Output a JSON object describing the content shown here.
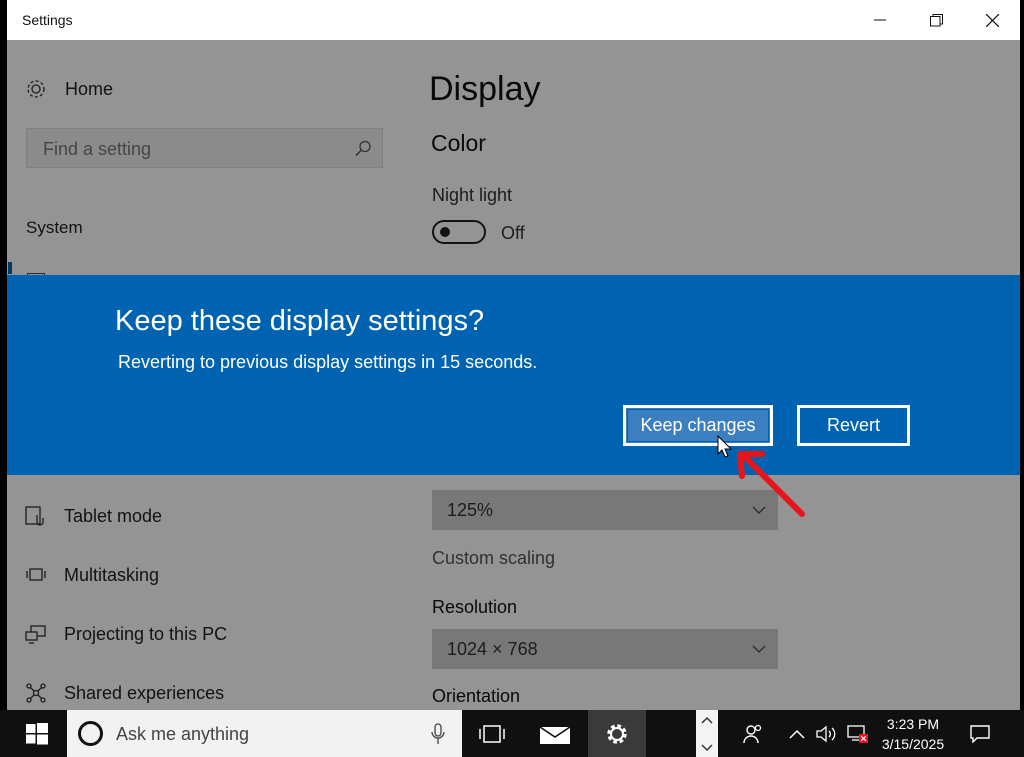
{
  "window": {
    "title": "Settings",
    "controls": {
      "minimize": "minimize-icon",
      "restore": "restore-icon",
      "close": "close-icon"
    }
  },
  "sidebar": {
    "home_label": "Home",
    "search_placeholder": "Find a setting",
    "section_label": "System",
    "items": [
      {
        "label": "Tablet mode",
        "icon": "tablet-mode-icon"
      },
      {
        "label": "Multitasking",
        "icon": "multitasking-icon"
      },
      {
        "label": "Projecting to this PC",
        "icon": "projecting-icon"
      },
      {
        "label": "Shared experiences",
        "icon": "shared-experiences-icon"
      }
    ]
  },
  "main": {
    "title": "Display",
    "color_heading": "Color",
    "night_light_label": "Night light",
    "night_light_state": "Off",
    "scale_value": "125%",
    "custom_scaling_link": "Custom scaling",
    "resolution_label": "Resolution",
    "resolution_value": "1024 × 768",
    "orientation_label": "Orientation"
  },
  "dialog": {
    "title": "Keep these display settings?",
    "message": "Reverting to previous display settings in 15 seconds.",
    "keep_label": "Keep changes",
    "revert_label": "Revert"
  },
  "taskbar": {
    "search_placeholder": "Ask me anything",
    "time": "3:23 PM",
    "date": "3/15/2025"
  },
  "colors": {
    "dialog_blue": "#0063b1",
    "annotation_red": "#e8141c",
    "taskbar": "#101010"
  }
}
